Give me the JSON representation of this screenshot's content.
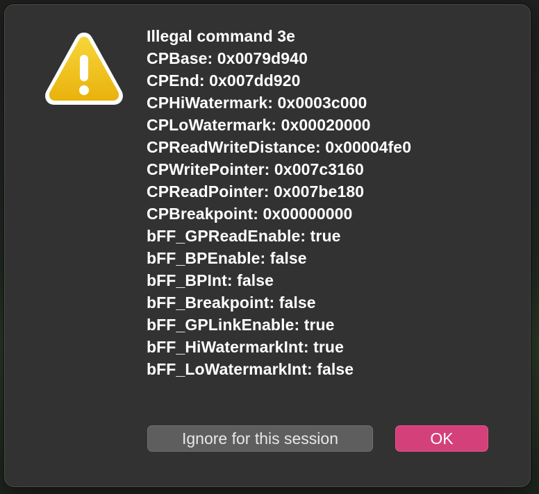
{
  "dialog": {
    "message_lines": [
      "Illegal command 3e",
      "CPBase: 0x0079d940",
      "CPEnd: 0x007dd920",
      "CPHiWatermark: 0x0003c000",
      "CPLoWatermark: 0x00020000",
      "CPReadWriteDistance: 0x00004fe0",
      "CPWritePointer: 0x007c3160",
      "CPReadPointer: 0x007be180",
      "CPBreakpoint: 0x00000000",
      "bFF_GPReadEnable: true",
      "bFF_BPEnable: false",
      "bFF_BPInt: false",
      "bFF_Breakpoint: false",
      "bFF_GPLinkEnable: true",
      "bFF_HiWatermarkInt: true",
      "bFF_LoWatermarkInt: false"
    ],
    "icon": "warning-triangle-icon",
    "buttons": {
      "ignore_label": "Ignore for this session",
      "ok_label": "OK"
    }
  },
  "colors": {
    "dialog_bg": "#323232",
    "icon_yellow": "#f2c40f",
    "ok_button": "#d4407a",
    "ignore_button": "#5e5e5e",
    "text": "#ffffff"
  }
}
